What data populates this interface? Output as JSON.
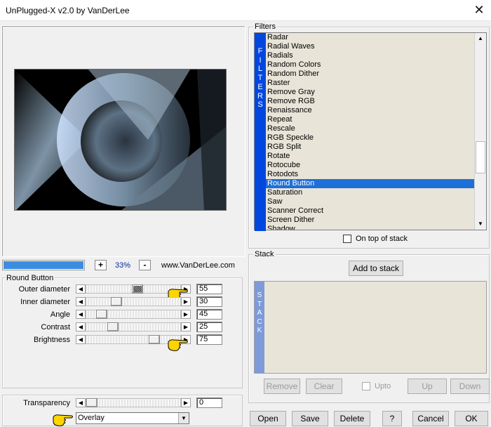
{
  "window": {
    "title": "UnPlugged-X v2.0 by VanDerLee",
    "close_glyph": "✕"
  },
  "preview": {
    "zoom_minus": "-",
    "zoom_plus": "+",
    "zoom": "33%",
    "website": "www.VanDerLee.com",
    "progress": 1.0
  },
  "round_button": {
    "group_title": "Round Button",
    "sliders": [
      {
        "label": "Outer diameter",
        "value": "55",
        "fraction": 0.55
      },
      {
        "label": "Inner diameter",
        "value": "30",
        "fraction": 0.3
      },
      {
        "label": "Angle",
        "value": "45",
        "fraction": 0.12
      },
      {
        "label": "Contrast",
        "value": "25",
        "fraction": 0.25
      },
      {
        "label": "Brightness",
        "value": "75",
        "fraction": 0.75
      }
    ]
  },
  "transparency": {
    "label": "Transparency",
    "value": "0",
    "fraction": 0.0
  },
  "blend_mode": {
    "selected": "Overlay"
  },
  "filters": {
    "group_title": "Filters",
    "strip_letters": [
      "F",
      "I",
      "L",
      "T",
      "E",
      "R",
      "S"
    ],
    "items": [
      "Radar",
      "Radial Waves",
      "Radials",
      "Random Colors",
      "Random Dither",
      "Raster",
      "Remove Gray",
      "Remove RGB",
      "Renaissance",
      "Repeat",
      "Rescale",
      "RGB Speckle",
      "RGB Split",
      "Rotate",
      "Rotocube",
      "Rotodots",
      "Round Button",
      "Saturation",
      "Saw",
      "Scanner Correct",
      "Screen Dither",
      "Shadow"
    ],
    "selected_index": 16,
    "on_top_label": "On top of stack"
  },
  "stack": {
    "group_title": "Stack",
    "add_label": "Add to stack",
    "strip_letters": [
      "S",
      "T",
      "A",
      "C",
      "K"
    ],
    "remove_label": "Remove",
    "clear_label": "Clear",
    "upto_label": "Upto",
    "up_label": "Up",
    "down_label": "Down"
  },
  "bottom": {
    "open": "Open",
    "save": "Save",
    "delete": "Delete",
    "help": "?",
    "cancel": "Cancel",
    "ok": "OK"
  },
  "colors": {
    "accent": "#1e6fd8",
    "filters_strip": "#0047e0",
    "stack_strip": "#7e9ad8"
  }
}
